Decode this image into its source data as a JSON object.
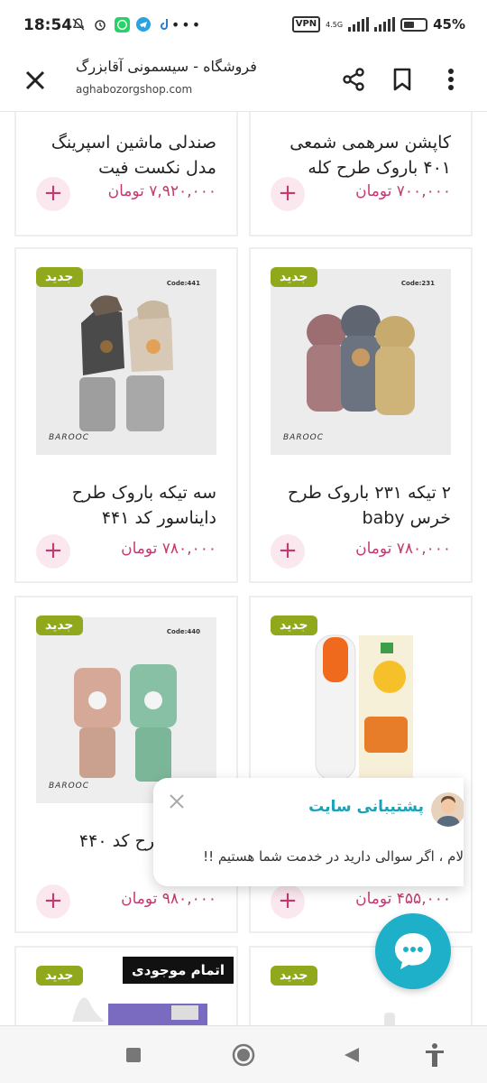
{
  "status_bar": {
    "time": "18:54",
    "vpn": "VPN",
    "network": "4.5G",
    "battery": "45%"
  },
  "browser": {
    "title": "فروشگاه - سیسمونی آقابزرگ",
    "url": "aghabozorgshop.com",
    "icons": [
      "close-icon",
      "share-icon",
      "bookmark-icon",
      "more-vert-icon"
    ]
  },
  "products": [
    {
      "title": "کاپشن سرهمی شمعی ۴۰۱ باروک طرح کله",
      "price": "۷۰۰,۰۰۰ تومان",
      "badge": "",
      "code": "",
      "brand": ""
    },
    {
      "title": "صندلی ماشین اسپرینگ مدل نکست فیت",
      "price": "۷,۹۲۰,۰۰۰ تومان",
      "badge": "",
      "code": "",
      "brand": ""
    },
    {
      "title": "۲ تیکه ۲۳۱ باروک طرح خرس baby",
      "price": "۷۸۰,۰۰۰ تومان",
      "badge": "جدید",
      "code": "Code:231",
      "brand": "BAROOC"
    },
    {
      "title": "سه تیکه باروک طرح دایناسور کد ۴۴۱",
      "price": "۷۸۰,۰۰۰ تومان",
      "badge": "جدید",
      "code": "Code:441",
      "brand": "BAROOC"
    },
    {
      "title": "",
      "price": "۴۵۵,۰۰۰ تومان",
      "badge": "جدید",
      "code": "",
      "brand": ""
    },
    {
      "title": "باروک طرح کد ۴۴۰",
      "price": "۹۸۰,۰۰۰ تومان",
      "badge": "جدید",
      "code": "Code:440",
      "brand": "BAROOC"
    },
    {
      "title": "",
      "price": "",
      "badge": "جدید",
      "code": "",
      "brand": ""
    },
    {
      "title": "",
      "price": "",
      "badge": "جدید",
      "code": "",
      "brand": ""
    }
  ],
  "add_label": "+",
  "out_of_stock_label": "اتمام موجودی",
  "chat": {
    "title": "پشتیبانی سایت",
    "message": "لام ، اگر سوالی دارید در خدمت شما هستیم !!"
  },
  "colors": {
    "price": "#c23a6f",
    "badge": "#8fa81c",
    "chat_accent": "#1fb0c9"
  }
}
